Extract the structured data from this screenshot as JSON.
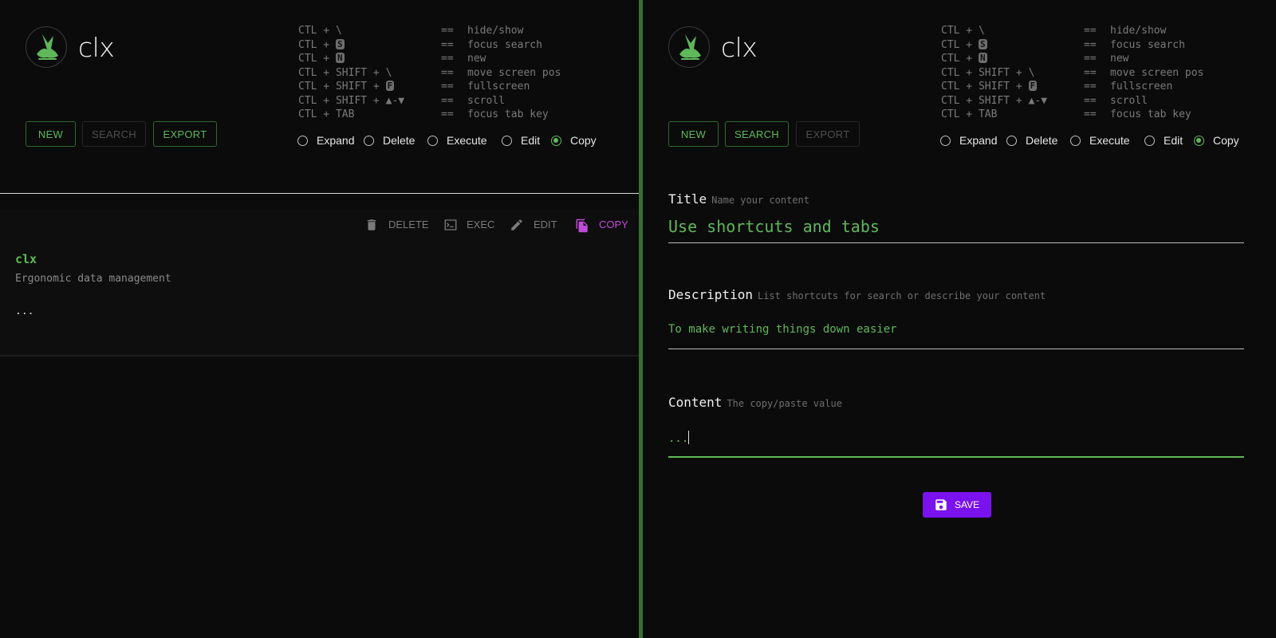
{
  "app": {
    "title": "clx",
    "logo_icon": "bird-icon",
    "accent": "#5fb85a",
    "copy_active": "#c04ad8",
    "save_color": "#7a12f0"
  },
  "shortcuts": [
    {
      "keys_pre": "CTL + \\",
      "key": "",
      "keys_post": "",
      "eq": "==",
      "desc": "hide/show"
    },
    {
      "keys_pre": "CTL + ",
      "key": "S",
      "keys_post": "",
      "eq": "==",
      "desc": "focus search"
    },
    {
      "keys_pre": "CTL + ",
      "key": "N",
      "keys_post": "",
      "eq": "==",
      "desc": "new"
    },
    {
      "keys_pre": "CTL + SHIFT + \\",
      "key": "",
      "keys_post": "",
      "eq": "==",
      "desc": "move screen pos"
    },
    {
      "keys_pre": "CTL + SHIFT + ",
      "key": "F",
      "keys_post": "",
      "eq": "==",
      "desc": "fullscreen"
    },
    {
      "keys_pre": "CTL + SHIFT + ▲-▼",
      "key": "",
      "keys_post": "",
      "eq": "==",
      "desc": "scroll"
    },
    {
      "keys_pre": "CTL + TAB",
      "key": "",
      "keys_post": "",
      "eq": "==",
      "desc": "focus tab key"
    }
  ],
  "left": {
    "buttons": {
      "new": "NEW",
      "search": "SEARCH",
      "export": "EXPORT"
    },
    "radios": {
      "expand": "Expand",
      "delete": "Delete",
      "execute": "Execute",
      "edit": "Edit",
      "copy": "Copy",
      "selected": "Copy"
    },
    "card": {
      "actions": {
        "delete": "DELETE",
        "exec": "EXEC",
        "edit": "EDIT",
        "copy": "COPY"
      },
      "title": "clx",
      "description": "Ergonomic data management",
      "content": "..."
    }
  },
  "right": {
    "buttons": {
      "new": "NEW",
      "search": "SEARCH",
      "export": "EXPORT"
    },
    "radios": {
      "expand": "Expand",
      "delete": "Delete",
      "execute": "Execute",
      "edit": "Edit",
      "copy": "Copy",
      "selected": "Copy"
    },
    "form": {
      "title_label": "Title",
      "title_hint": "Name your content",
      "title_value": "Use shortcuts and tabs",
      "description_label": "Description",
      "description_hint": "List shortcuts for search or describe your content",
      "description_value": "To make writing things down easier",
      "content_label": "Content",
      "content_hint": "The copy/paste value",
      "content_value": "...",
      "save_label": "SAVE"
    }
  }
}
